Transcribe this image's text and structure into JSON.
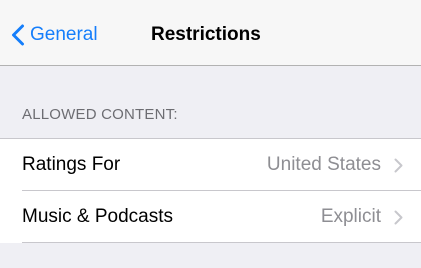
{
  "nav": {
    "back_label": "General",
    "title": "Restrictions"
  },
  "section": {
    "header": "ALLOWED CONTENT:"
  },
  "rows": [
    {
      "label": "Ratings For",
      "value": "United States"
    },
    {
      "label": "Music & Podcasts",
      "value": "Explicit"
    }
  ],
  "colors": {
    "accent": "#157efb",
    "background": "#efeff4",
    "separator": "#c8c7cc",
    "secondary_text": "#8e8e93"
  },
  "icons": {
    "back": "chevron-left-icon",
    "disclosure": "chevron-right-icon"
  }
}
